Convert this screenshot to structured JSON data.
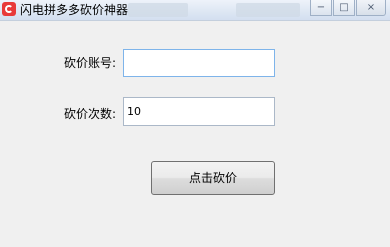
{
  "window": {
    "title": "闪电拼多多砍价神器",
    "caption_buttons": {
      "minimize": "−",
      "maximize": "□",
      "close": "×"
    }
  },
  "form": {
    "account_label": "砍价账号:",
    "account_value": "",
    "count_label": "砍价次数:",
    "count_value": "10",
    "submit_label": "点击砍价"
  },
  "colors": {
    "accent_icon": "#e83a3a",
    "input_focus_border": "#7eb4ea"
  }
}
